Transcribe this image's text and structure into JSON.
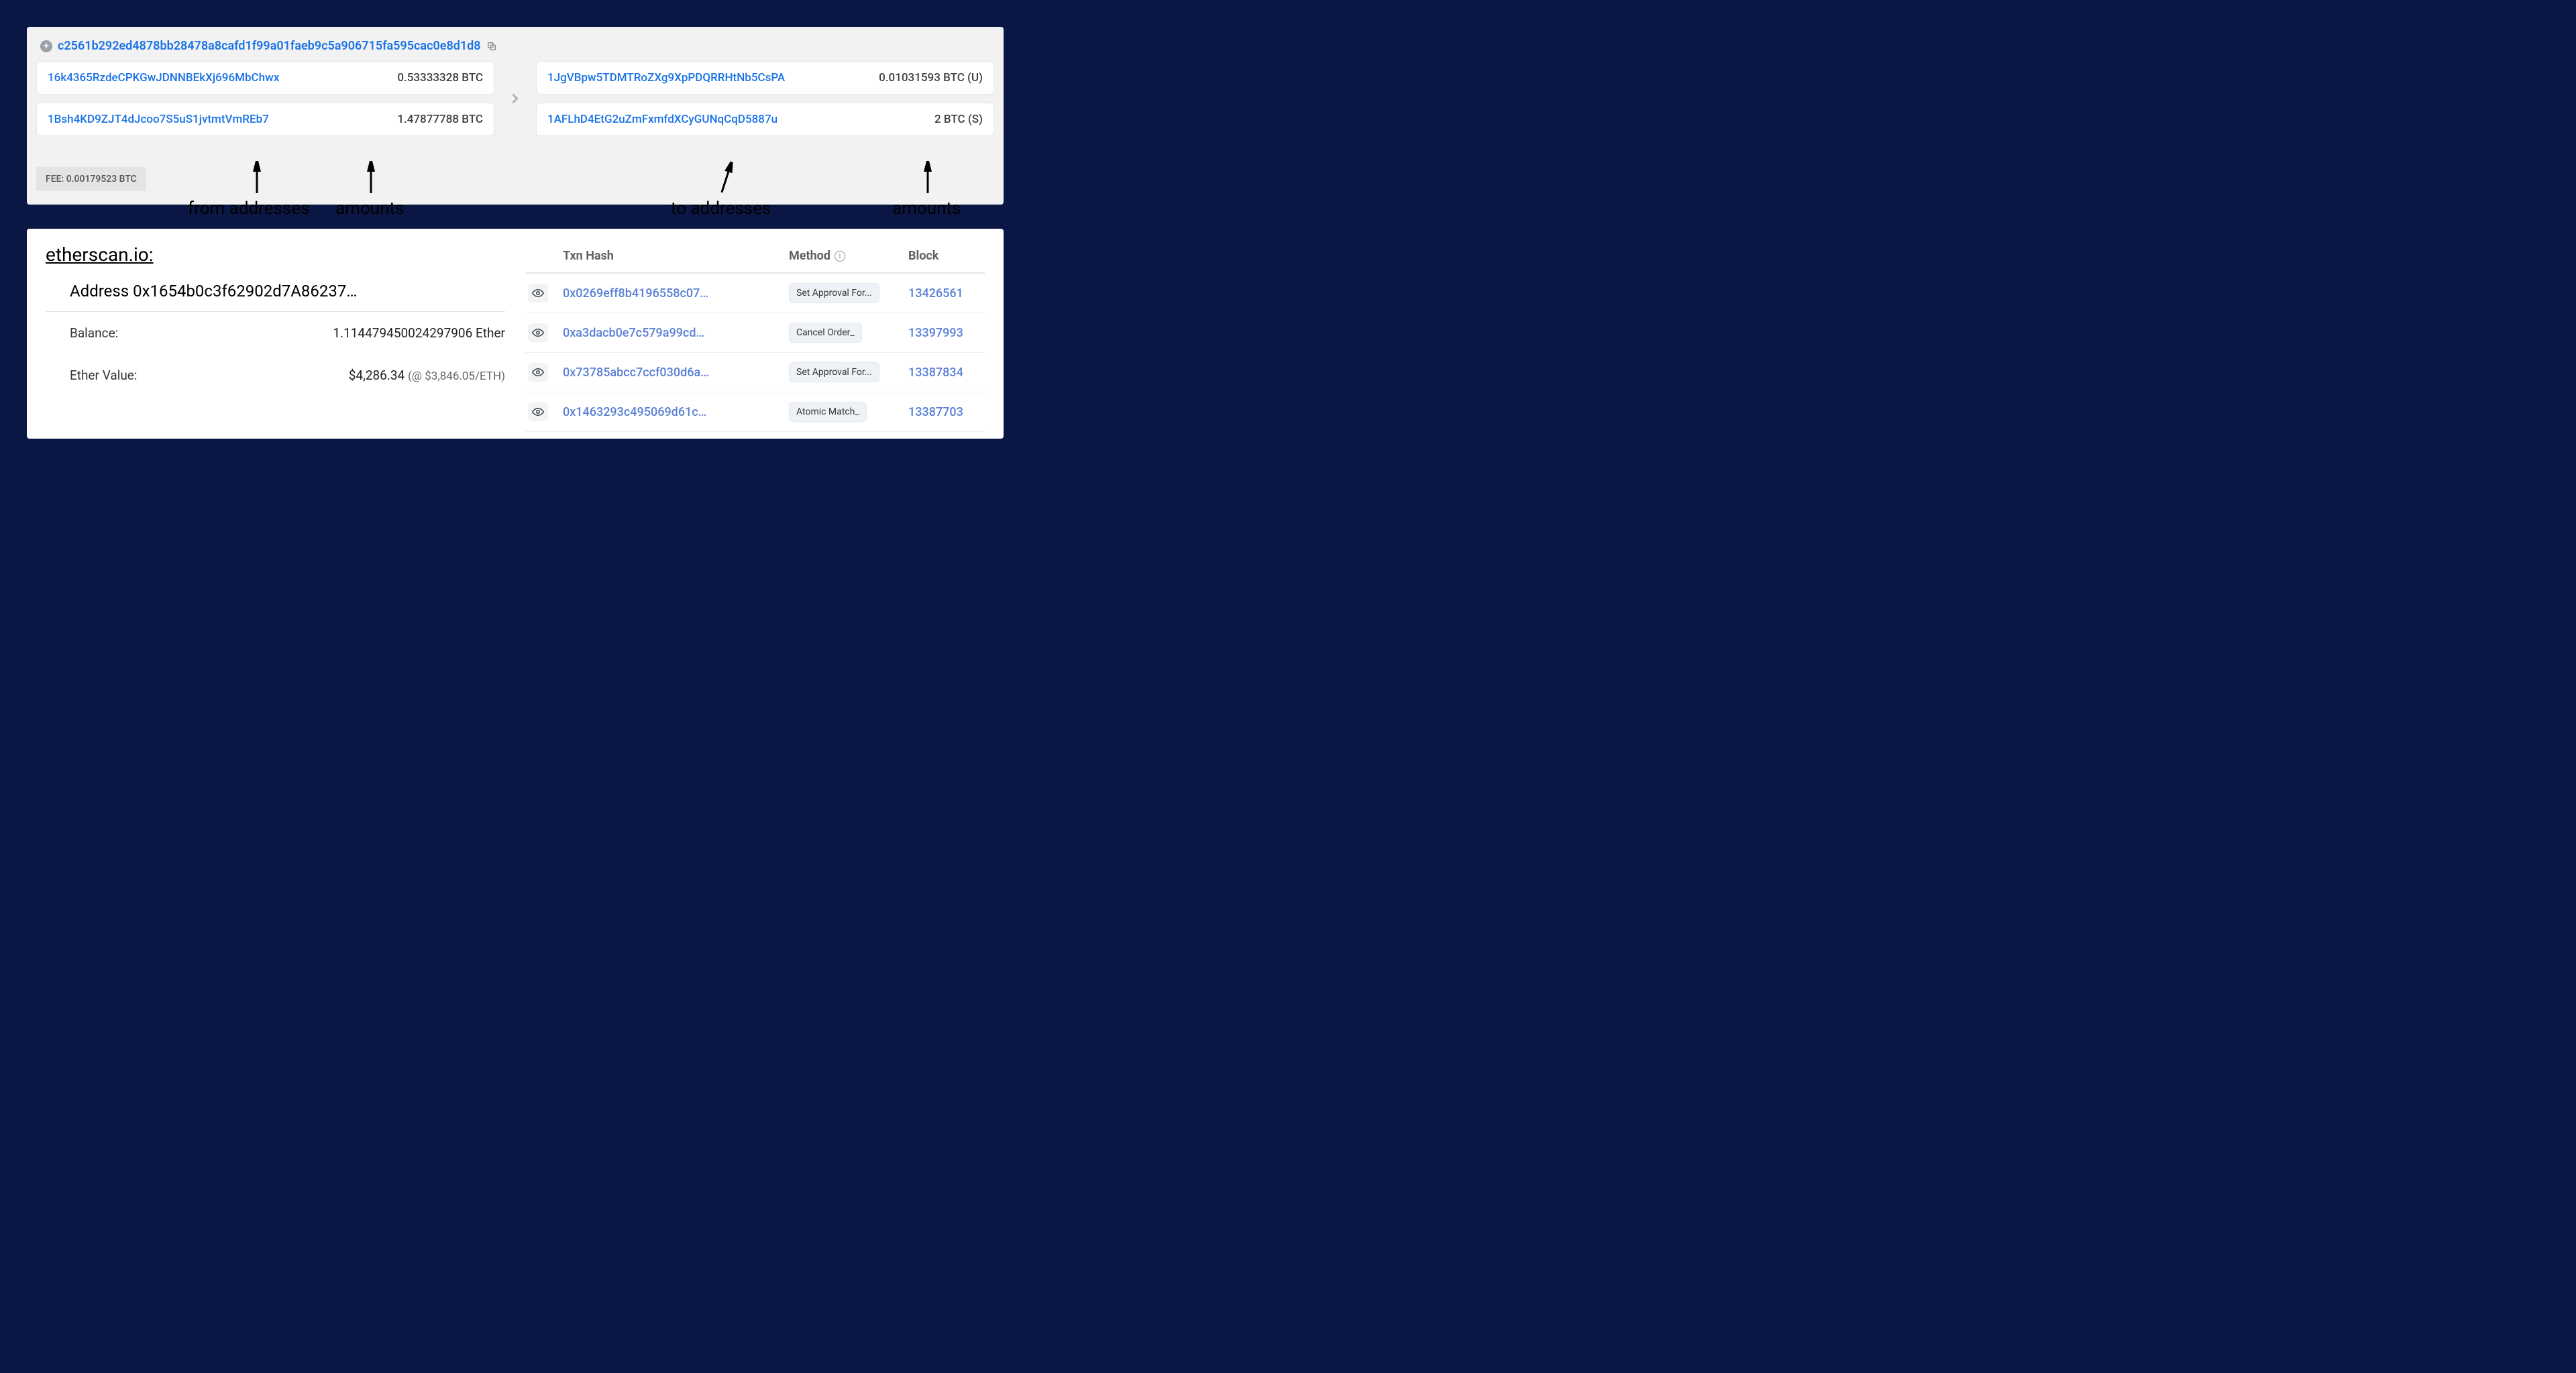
{
  "btc_tx": {
    "hash": "c2561b292ed4878bb28478a8cafd1f99a01faeb9c5a906715fa595cac0e8d1d8",
    "inputs": [
      {
        "address": "16k4365RzdeCPKGwJDNNBEkXj696MbChwx",
        "amount": "0.53333328 BTC"
      },
      {
        "address": "1Bsh4KD9ZJT4dJcoo7S5uS1jvtmtVmREb7",
        "amount": "1.47877788 BTC"
      }
    ],
    "outputs": [
      {
        "address": "1JgVBpw5TDMTRoZXg9XpPDQRRHtNb5CsPA",
        "amount": "0.01031593 BTC (U)"
      },
      {
        "address": "1AFLhD4EtG2uZmFxmfdXCyGUNqCqD5887u",
        "amount": "2 BTC (S)"
      }
    ],
    "fee_label": "FEE: 0.00179523 BTC"
  },
  "annotations": {
    "from": "from addresses",
    "amt1": "amounts",
    "to": "to addresses",
    "amt2": "amounts"
  },
  "etherscan": {
    "title": "etherscan.io:",
    "address_label": "Address 0x1654b0c3f62902d7A86237…",
    "balance_key": "Balance:",
    "balance_val": "1.114479450024297906 Ether",
    "value_key": "Ether Value:",
    "value_val": "$4,286.34",
    "value_sub": "(@ $3,846.05/ETH)"
  },
  "tx_table": {
    "headers": {
      "hash": "Txn Hash",
      "method": "Method",
      "block": "Block"
    },
    "rows": [
      {
        "hash": "0x0269eff8b4196558c07…",
        "method": "Set Approval For...",
        "block": "13426561"
      },
      {
        "hash": "0xa3dacb0e7c579a99cd…",
        "method": "Cancel Order_",
        "block": "13397993"
      },
      {
        "hash": "0x73785abcc7ccf030d6a…",
        "method": "Set Approval For...",
        "block": "13387834"
      },
      {
        "hash": "0x1463293c495069d61c…",
        "method": "Atomic Match_",
        "block": "13387703"
      }
    ]
  }
}
